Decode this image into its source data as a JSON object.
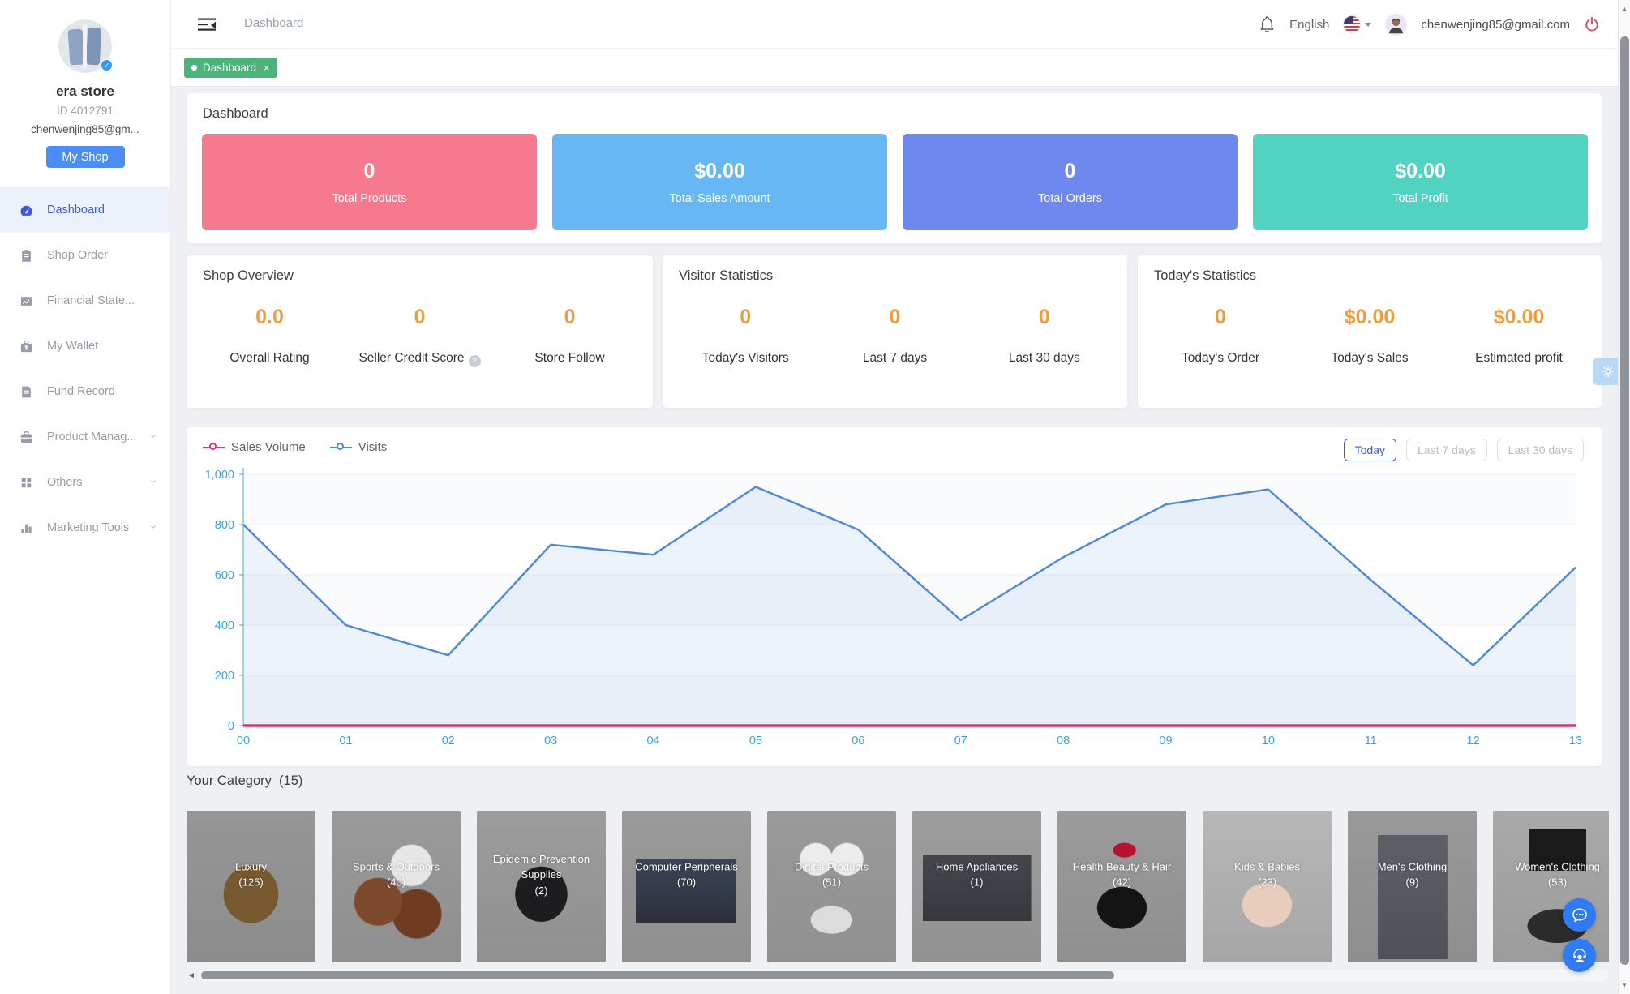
{
  "sidebar": {
    "store_name": "era store",
    "store_id": "ID 4012791",
    "email": "chenwenjing85@gm...",
    "my_shop_label": "My Shop",
    "items": [
      {
        "label": "Dashboard",
        "icon": "dashboard-icon",
        "active": true,
        "expandable": false
      },
      {
        "label": "Shop Order",
        "icon": "shop-order-icon",
        "active": false,
        "expandable": false
      },
      {
        "label": "Financial State...",
        "icon": "financial-statement-icon",
        "active": false,
        "expandable": false
      },
      {
        "label": "My Wallet",
        "icon": "wallet-icon",
        "active": false,
        "expandable": false
      },
      {
        "label": "Fund Record",
        "icon": "fund-record-icon",
        "active": false,
        "expandable": false
      },
      {
        "label": "Product Manag...",
        "icon": "product-management-icon",
        "active": false,
        "expandable": true
      },
      {
        "label": "Others",
        "icon": "others-grid-icon",
        "active": false,
        "expandable": true
      },
      {
        "label": "Marketing Tools",
        "icon": "marketing-tools-icon",
        "active": false,
        "expandable": true
      }
    ]
  },
  "topbar": {
    "breadcrumb": "Dashboard",
    "language": "English",
    "email": "chenwenjing85@gmail.com"
  },
  "tab": {
    "label": "Dashboard"
  },
  "overview": {
    "title": "Dashboard",
    "cards": [
      {
        "value": "0",
        "label": "Total Products",
        "color": "#f7798e"
      },
      {
        "value": "$0.00",
        "label": "Total Sales Amount",
        "color": "#66b7f3"
      },
      {
        "value": "0",
        "label": "Total Orders",
        "color": "#6f88f0"
      },
      {
        "value": "$0.00",
        "label": "Total Profit",
        "color": "#50d3c1"
      }
    ]
  },
  "stat_panels": [
    {
      "title": "Shop Overview",
      "stats": [
        {
          "value": "0.0",
          "label": "Overall Rating",
          "help": false
        },
        {
          "value": "0",
          "label": "Seller Credit Score",
          "help": true
        },
        {
          "value": "0",
          "label": "Store Follow",
          "help": false
        }
      ]
    },
    {
      "title": "Visitor Statistics",
      "stats": [
        {
          "value": "0",
          "label": "Today's Visitors",
          "help": false
        },
        {
          "value": "0",
          "label": "Last 7 days",
          "help": false
        },
        {
          "value": "0",
          "label": "Last 30 days",
          "help": false
        }
      ]
    },
    {
      "title": "Today's Statistics",
      "stats": [
        {
          "value": "0",
          "label": "Today's Order",
          "help": false
        },
        {
          "value": "$0.00",
          "label": "Today's Sales",
          "help": false
        },
        {
          "value": "$0.00",
          "label": "Estimated profit",
          "help": false
        }
      ]
    }
  ],
  "chart_data": {
    "type": "line",
    "x": [
      "00",
      "01",
      "02",
      "03",
      "04",
      "05",
      "06",
      "07",
      "08",
      "09",
      "10",
      "11",
      "12",
      "13"
    ],
    "series": [
      {
        "name": "Sales Volume",
        "color": "#e0336e",
        "values": [
          0,
          0,
          0,
          0,
          0,
          0,
          0,
          0,
          0,
          0,
          0,
          0,
          0,
          0
        ]
      },
      {
        "name": "Visits",
        "color": "#4f87d8",
        "values": [
          800,
          400,
          280,
          720,
          680,
          950,
          780,
          420,
          670,
          880,
          940,
          580,
          240,
          630
        ]
      }
    ],
    "ylim": [
      0,
      1000
    ],
    "ytick_labels": [
      "0",
      "200",
      "400",
      "600",
      "800",
      "1,000"
    ],
    "axis_label_color": "#38a1dd",
    "grid": true,
    "legend_position": "top-left",
    "range_buttons": [
      {
        "label": "Today",
        "active": true
      },
      {
        "label": "Last 7 days",
        "active": false
      },
      {
        "label": "Last 30 days",
        "active": false
      }
    ]
  },
  "category": {
    "title": "Your Category",
    "count": "(15)",
    "items": [
      {
        "name": "Luxury",
        "count": "(125)",
        "image": "handbag"
      },
      {
        "name": "Sports & Outdoors",
        "count": "(40)",
        "image": "balls"
      },
      {
        "name": "Epidemic Prevention Supplies",
        "count": "(2)",
        "image": "face-mask"
      },
      {
        "name": "Computer Peripherals",
        "count": "(70)",
        "image": "laptop"
      },
      {
        "name": "Digital Products",
        "count": "(51)",
        "image": "earbuds"
      },
      {
        "name": "Home Appliances",
        "count": "(1)",
        "image": "microwave"
      },
      {
        "name": "Health Beauty & Hair",
        "count": "(42)",
        "image": "lipstick"
      },
      {
        "name": "Kids & Babies",
        "count": "(23)",
        "image": "baby"
      },
      {
        "name": "Men's Clothing",
        "count": "(9)",
        "image": "suit"
      },
      {
        "name": "Women's Clothing",
        "count": "(53)",
        "image": "dress"
      }
    ]
  }
}
